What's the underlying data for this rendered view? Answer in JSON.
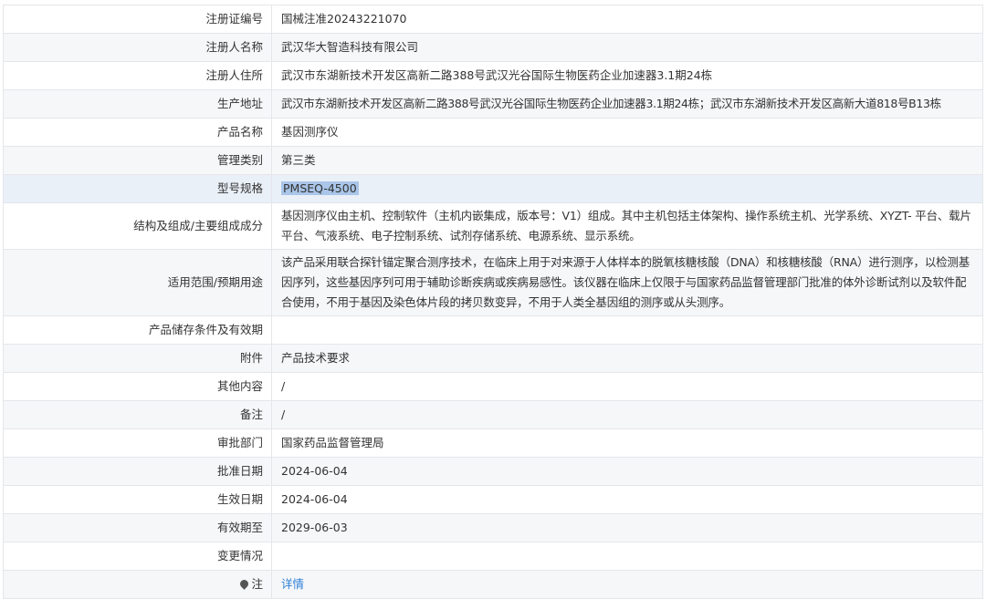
{
  "rows": [
    {
      "label": "注册证编号",
      "value": "国械注准20243221070"
    },
    {
      "label": "注册人名称",
      "value": "武汉华大智造科技有限公司"
    },
    {
      "label": "注册人住所",
      "value": "武汉市东湖新技术开发区高新二路388号武汉光谷国际生物医药企业加速器3.1期24栋"
    },
    {
      "label": "生产地址",
      "value": "武汉市东湖新技术开发区高新二路388号武汉光谷国际生物医药企业加速器3.1期24栋；武汉市东湖新技术开发区高新大道818号B13栋"
    },
    {
      "label": "产品名称",
      "value": "基因测序仪"
    },
    {
      "label": "管理类别",
      "value": "第三类"
    },
    {
      "label": "型号规格",
      "value": "PMSEQ-4500"
    },
    {
      "label": "结构及组成/主要组成成分",
      "value": "基因测序仪由主机、控制软件（主机内嵌集成，版本号：V1）组成。其中主机包括主体架构、操作系统主机、光学系统、XYZT- 平台、载片平台、气液系统、电子控制系统、试剂存储系统、电源系统、显示系统。"
    },
    {
      "label": "适用范围/预期用途",
      "value": "该产品采用联合探针锚定聚合测序技术，在临床上用于对来源于人体样本的脱氧核糖核酸（DNA）和核糖核酸（RNA）进行测序，以检测基因序列，这些基因序列可用于辅助诊断疾病或疾病易感性。该仪器在临床上仅限于与国家药品监督管理部门批准的体外诊断试剂以及软件配合使用，不用于基因及染色体片段的拷贝数变异，不用于人类全基因组的测序或从头测序。"
    },
    {
      "label": "产品储存条件及有效期",
      "value": ""
    },
    {
      "label": "附件",
      "value": "产品技术要求"
    },
    {
      "label": "其他内容",
      "value": "/"
    },
    {
      "label": "备注",
      "value": "/"
    },
    {
      "label": "审批部门",
      "value": "国家药品监督管理局"
    },
    {
      "label": "批准日期",
      "value": "2024-06-04"
    },
    {
      "label": "生效日期",
      "value": "2024-06-04"
    },
    {
      "label": "有效期至",
      "value": "2029-06-03"
    },
    {
      "label": "变更情况",
      "value": ""
    },
    {
      "label": "注",
      "value": "详情",
      "icon": "map-pin-icon"
    }
  ],
  "colors": {
    "link": "#2d7fd6",
    "selection": "#a9c5e8",
    "row_alt": "#f6f7f9",
    "border": "#e4e6ea"
  }
}
